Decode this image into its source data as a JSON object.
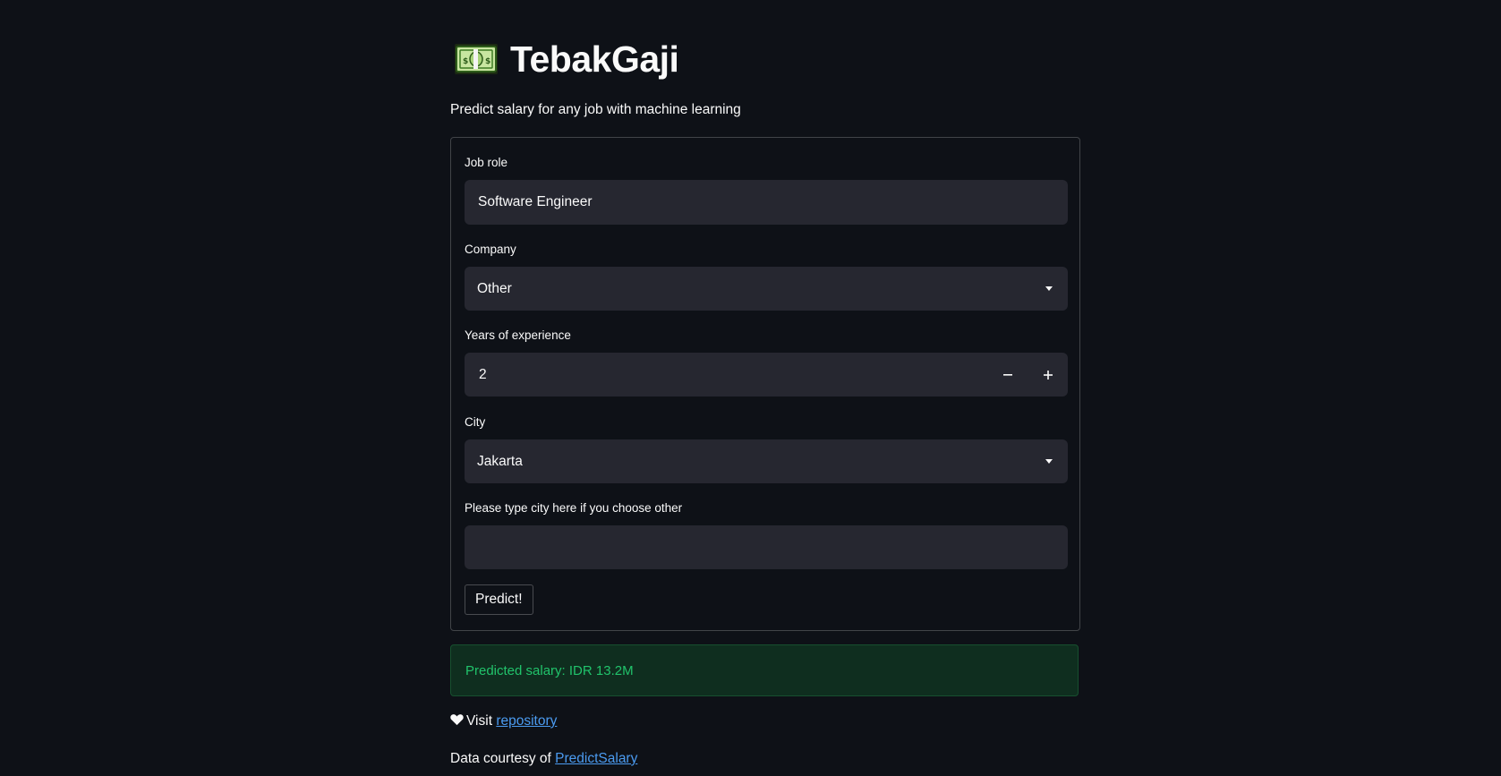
{
  "app": {
    "title": "TebakGaji",
    "title_icon": "money-bill-icon",
    "subtitle": "Predict salary for any job with machine learning"
  },
  "form": {
    "job_role": {
      "label": "Job role",
      "value": "Software Engineer"
    },
    "company": {
      "label": "Company",
      "selected": "Other"
    },
    "experience": {
      "label": "Years of experience",
      "value": "2",
      "decrement_icon": "minus-icon",
      "increment_icon": "plus-icon"
    },
    "city": {
      "label": "City",
      "selected": "Jakarta"
    },
    "other_city": {
      "label": "Please type city here if you choose other",
      "value": ""
    },
    "submit_label": "Predict!"
  },
  "result": {
    "message": "Predicted salary: IDR 13.2M",
    "color": "#21c36b",
    "background": "#0f2e1f"
  },
  "footer": {
    "visit_prefix": "Visit",
    "repository_link": "repository",
    "courtesy_prefix": "Data courtesy of",
    "courtesy_link": "PredictSalary",
    "heart_icon": "heart-icon"
  },
  "colors": {
    "background": "#0e1117",
    "field": "#262730",
    "link": "#4b9bf0"
  }
}
